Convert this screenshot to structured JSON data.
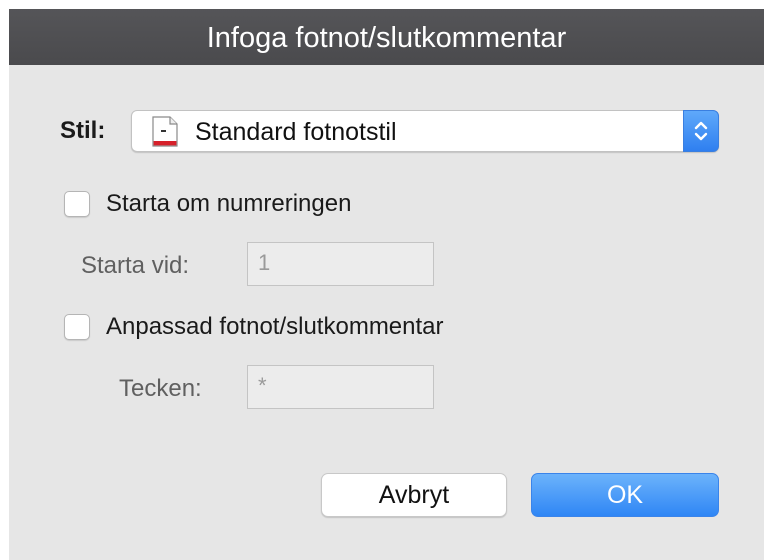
{
  "window": {
    "title": "Infoga fotnot/slutkommentar"
  },
  "style_row": {
    "label": "Stil:",
    "selected": "Standard fotnotstil",
    "icon": "document-style-icon"
  },
  "restart_numbering": {
    "label": "Starta om numreringen",
    "checked": false,
    "start_at_label": "Starta vid:",
    "start_at_value": "1"
  },
  "custom_mark": {
    "label": "Anpassad fotnot/slutkommentar",
    "checked": false,
    "char_label": "Tecken:",
    "char_value": "*"
  },
  "buttons": {
    "cancel": "Avbryt",
    "ok": "OK"
  },
  "colors": {
    "accent": "#3b8cf6",
    "title_bar": "#4e4e51",
    "panel": "#e6e6e6"
  }
}
